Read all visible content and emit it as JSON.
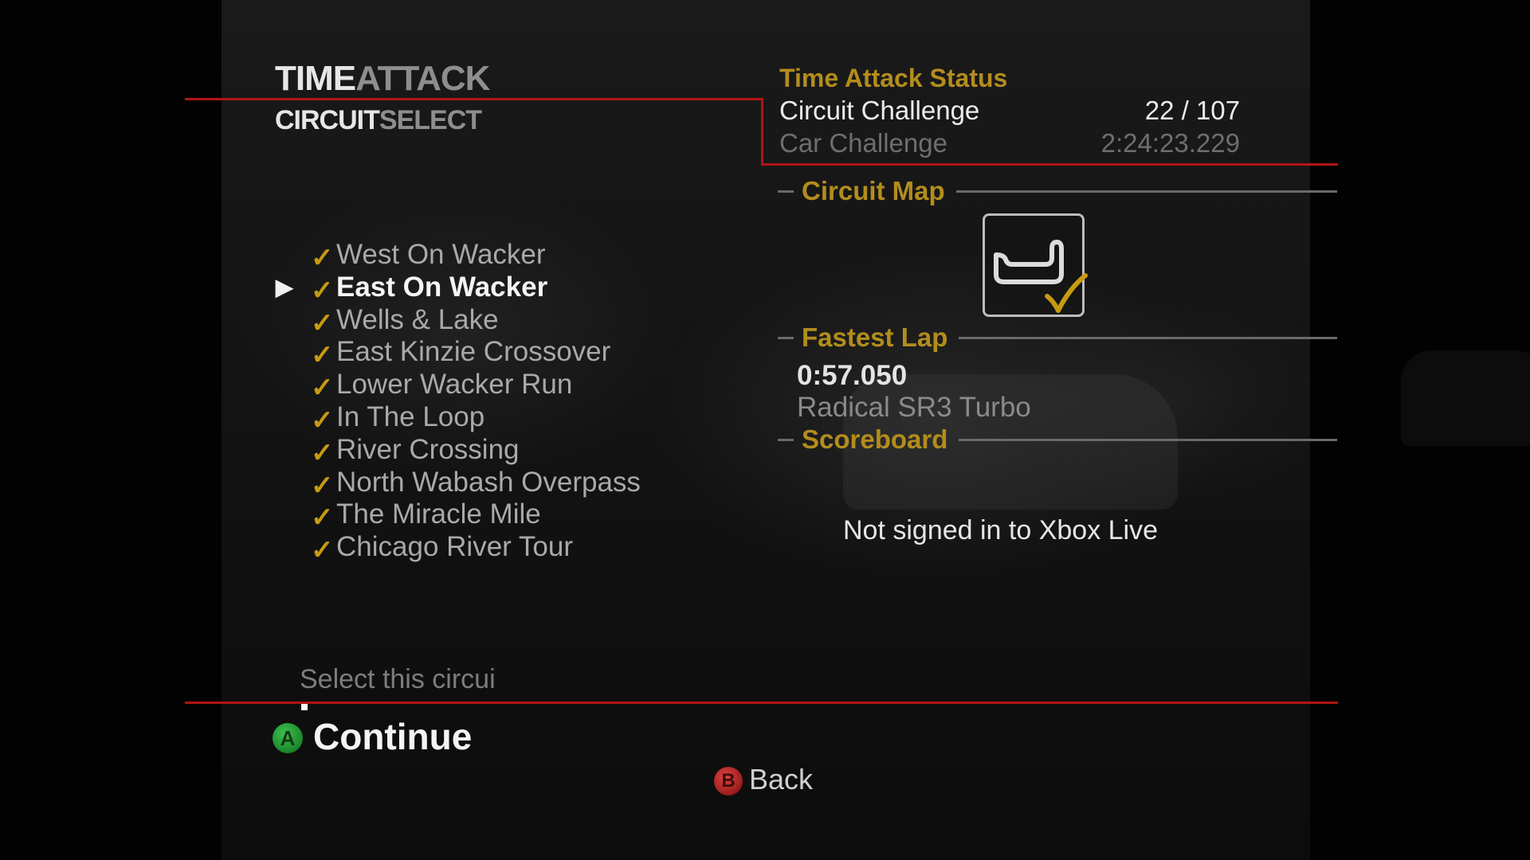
{
  "header": {
    "title_bold": "TIME",
    "title_light": "ATTACK",
    "subtitle_bold": "CIRCUIT",
    "subtitle_light": "SELECT"
  },
  "status": {
    "title": "Time Attack Status",
    "rows": [
      {
        "label": "Circuit Challenge",
        "value": "22 / 107"
      },
      {
        "label": "Car Challenge",
        "value": "2:24:23.229"
      }
    ]
  },
  "sections": {
    "circuit_map": "Circuit Map",
    "fastest_lap": "Fastest Lap",
    "scoreboard": "Scoreboard"
  },
  "fastest_lap": {
    "time": "0:57.050",
    "car": "Radical SR3 Turbo"
  },
  "scoreboard": {
    "message": "Not signed in to Xbox Live"
  },
  "circuits": [
    {
      "name": "West On Wacker",
      "selected": false
    },
    {
      "name": "East On Wacker",
      "selected": true
    },
    {
      "name": "Wells & Lake",
      "selected": false
    },
    {
      "name": "East Kinzie Crossover",
      "selected": false
    },
    {
      "name": "Lower Wacker Run",
      "selected": false
    },
    {
      "name": "In The Loop",
      "selected": false
    },
    {
      "name": "River Crossing",
      "selected": false
    },
    {
      "name": "North Wabash Overpass",
      "selected": false
    },
    {
      "name": "The Miracle Mile",
      "selected": false
    },
    {
      "name": "Chicago River Tour",
      "selected": false
    }
  ],
  "hint": "Select this circui",
  "footer": {
    "continue_glyph": "A",
    "continue_label": "Continue",
    "back_glyph": "B",
    "back_label": "Back"
  },
  "icons": {
    "check": "checkmark-icon",
    "cursor": "triangle-right-icon",
    "map": "circuit-map-icon"
  },
  "colors": {
    "accent_gold": "#b38d1c",
    "check_gold": "#c69b12",
    "line_red": "#b11414",
    "button_a": "#2fa83f",
    "button_b": "#c92a2a"
  }
}
